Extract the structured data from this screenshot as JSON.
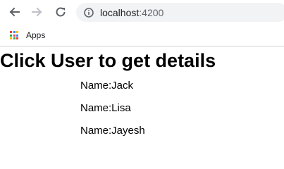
{
  "browser": {
    "url_host": "localhost",
    "url_port": ":4200",
    "icons": {
      "back": "back-arrow-icon",
      "forward": "forward-arrow-icon",
      "reload": "reload-icon",
      "site_info": "info-icon"
    }
  },
  "bookmarks": {
    "apps_label": "Apps",
    "apps_icon_colors": [
      "#ea4335",
      "#4285f4",
      "#fbbc05",
      "#34a853",
      "#ea4335",
      "#4285f4",
      "#fbbc05",
      "#34a853",
      "#ea4335"
    ]
  },
  "page": {
    "heading": "Click User to get details",
    "users": [
      {
        "label": "Name:Jack"
      },
      {
        "label": "Name:Lisa"
      },
      {
        "label": "Name:Jayesh"
      }
    ]
  }
}
